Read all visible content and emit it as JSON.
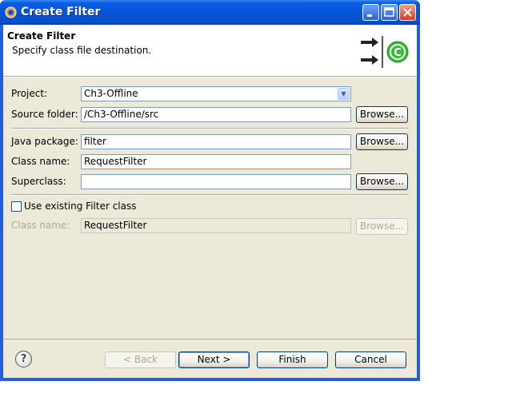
{
  "window": {
    "title": "Create Filter"
  },
  "banner": {
    "title": "Create Filter",
    "subtitle": "Specify class file destination."
  },
  "form": {
    "project_label": "Project:",
    "project_value": "Ch3-Offline",
    "source_folder_label": "Source folder:",
    "source_folder_value": "/Ch3-Offline/src",
    "java_package_label": "Java package:",
    "java_package_value": "filter",
    "class_name_label": "Class name:",
    "class_name_value": "RequestFilter",
    "superclass_label": "Superclass:",
    "superclass_value": "",
    "use_existing_label": "Use existing Filter class",
    "existing_class_name_label": "Class name:",
    "existing_class_name_value": "RequestFilter",
    "browse_label": "Browse..."
  },
  "footer": {
    "help": "?",
    "back_label": "< Back",
    "next_label": "Next >",
    "finish_label": "Finish",
    "cancel_label": "Cancel"
  },
  "colors": {
    "title_bar": "#0554d8",
    "dialog_bg": "#ece9d8",
    "accent_green": "#3cb83c"
  },
  "icons": [
    "eclipse-app-icon",
    "minimize-icon",
    "maximize-icon",
    "close-icon",
    "wizard-banner-icon",
    "chevron-down-icon",
    "help-icon"
  ]
}
